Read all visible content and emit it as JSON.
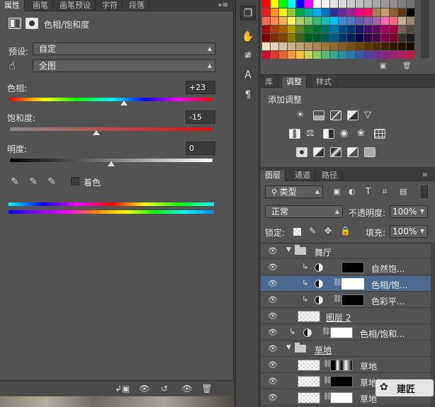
{
  "properties_panel": {
    "tabs": [
      "属性",
      "画笔",
      "画笔预设",
      "字符",
      "段落"
    ],
    "menu_icon": "»≡",
    "title": "色相/饱和度",
    "preset_label": "预设:",
    "preset_value": "自定",
    "channel_value": "全图",
    "hue_label": "色相:",
    "hue_value": "+23",
    "saturation_label": "饱和度:",
    "saturation_value": "-15",
    "lightness_label": "明度:",
    "lightness_value": "0",
    "colorize_label": "着色",
    "hue_slider_fraction": 0.564,
    "saturation_slider_fraction": 0.425,
    "lightness_slider_fraction": 0.5
  },
  "adjustments_panel": {
    "tabs": [
      "库",
      "调整",
      "样式"
    ],
    "title": "添加调整"
  },
  "layers_panel": {
    "tabs": [
      "图层",
      "通道",
      "路径"
    ],
    "filter_kind": "类型",
    "blend_mode": "正常",
    "opacity_label": "不透明度:",
    "opacity_value": "100%",
    "lock_label": "锁定:",
    "fill_label": "填充:",
    "fill_value": "100%",
    "layers": [
      {
        "name": "舞厅"
      },
      {
        "name": "自然饱..."
      },
      {
        "name": "色相/饱..."
      },
      {
        "name": "色彩平..."
      },
      {
        "name": "图层 2"
      },
      {
        "name": "色相/饱和..."
      },
      {
        "name": "草地"
      },
      {
        "name": "草地"
      },
      {
        "name": "草地"
      },
      {
        "name": "草地"
      }
    ]
  },
  "watermark": {
    "text": "建匠"
  },
  "colors": {
    "panel_bg": "#535353",
    "selected_row": "#4b6a8f"
  }
}
